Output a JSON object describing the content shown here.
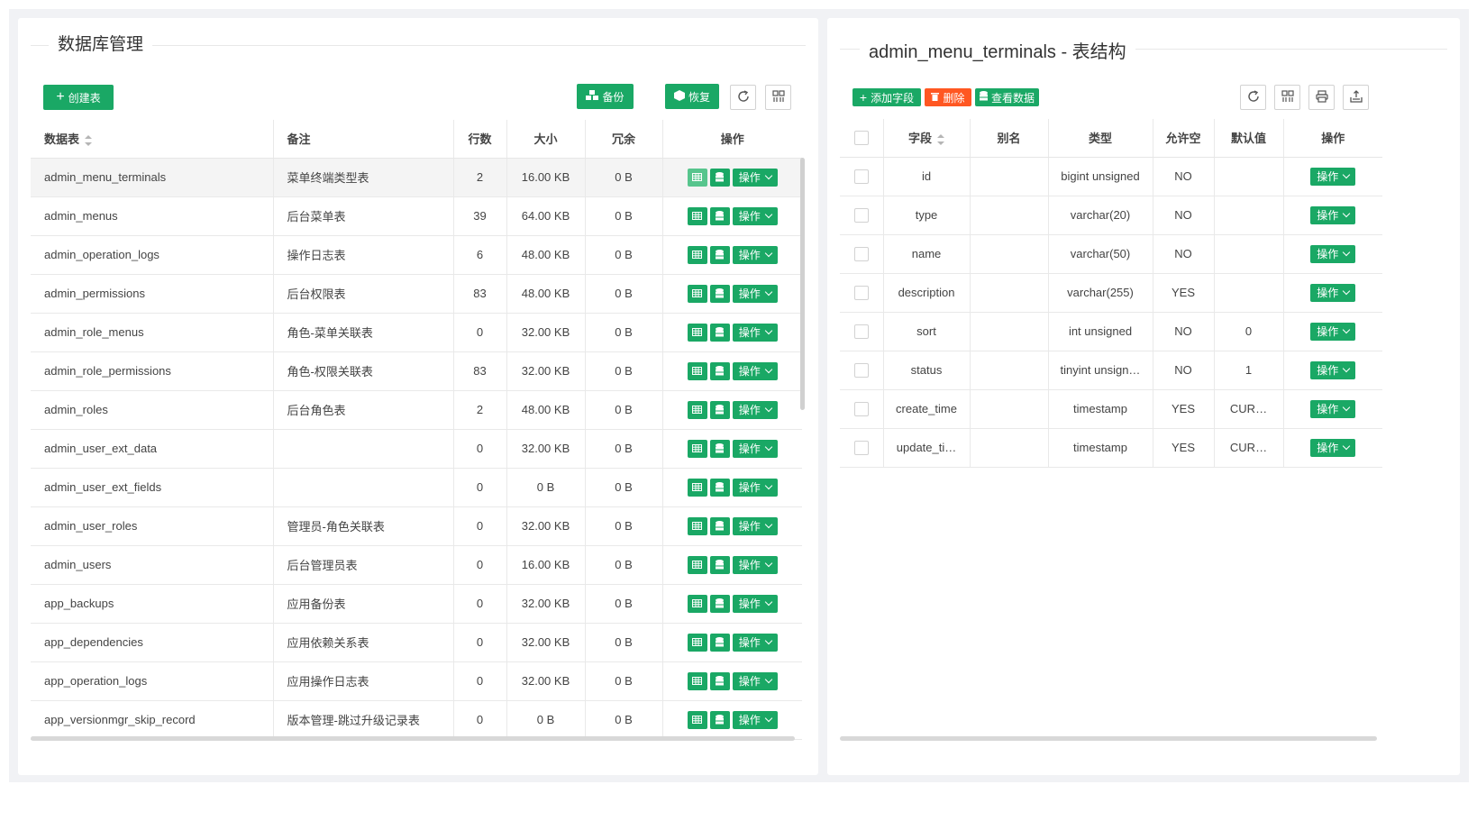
{
  "left": {
    "title": "数据库管理",
    "toolbar": {
      "create_label": "创建表",
      "backup_label": "备份",
      "restore_label": "恢复"
    },
    "columns": [
      "数据表",
      "备注",
      "行数",
      "大小",
      "冗余",
      "操作"
    ],
    "action_label": "操作",
    "rows": [
      {
        "name": "admin_menu_terminals",
        "comment": "菜单终端类型表",
        "rows": "2",
        "size": "16.00 KB",
        "free": "0 B"
      },
      {
        "name": "admin_menus",
        "comment": "后台菜单表",
        "rows": "39",
        "size": "64.00 KB",
        "free": "0 B"
      },
      {
        "name": "admin_operation_logs",
        "comment": "操作日志表",
        "rows": "6",
        "size": "48.00 KB",
        "free": "0 B"
      },
      {
        "name": "admin_permissions",
        "comment": "后台权限表",
        "rows": "83",
        "size": "48.00 KB",
        "free": "0 B"
      },
      {
        "name": "admin_role_menus",
        "comment": "角色-菜单关联表",
        "rows": "0",
        "size": "32.00 KB",
        "free": "0 B"
      },
      {
        "name": "admin_role_permissions",
        "comment": "角色-权限关联表",
        "rows": "83",
        "size": "32.00 KB",
        "free": "0 B"
      },
      {
        "name": "admin_roles",
        "comment": "后台角色表",
        "rows": "2",
        "size": "48.00 KB",
        "free": "0 B"
      },
      {
        "name": "admin_user_ext_data",
        "comment": "",
        "rows": "0",
        "size": "32.00 KB",
        "free": "0 B"
      },
      {
        "name": "admin_user_ext_fields",
        "comment": "",
        "rows": "0",
        "size": "0 B",
        "free": "0 B"
      },
      {
        "name": "admin_user_roles",
        "comment": "管理员-角色关联表",
        "rows": "0",
        "size": "32.00 KB",
        "free": "0 B"
      },
      {
        "name": "admin_users",
        "comment": "后台管理员表",
        "rows": "0",
        "size": "16.00 KB",
        "free": "0 B"
      },
      {
        "name": "app_backups",
        "comment": "应用备份表",
        "rows": "0",
        "size": "32.00 KB",
        "free": "0 B"
      },
      {
        "name": "app_dependencies",
        "comment": "应用依赖关系表",
        "rows": "0",
        "size": "32.00 KB",
        "free": "0 B"
      },
      {
        "name": "app_operation_logs",
        "comment": "应用操作日志表",
        "rows": "0",
        "size": "32.00 KB",
        "free": "0 B"
      },
      {
        "name": "app_versionmgr_skip_record",
        "comment": "版本管理-跳过升级记录表",
        "rows": "0",
        "size": "0 B",
        "free": "0 B"
      }
    ]
  },
  "right": {
    "title": "admin_menu_terminals - 表结构",
    "toolbar": {
      "add_field_label": "添加字段",
      "delete_label": "删除",
      "view_data_label": "查看数据"
    },
    "columns": [
      "字段",
      "别名",
      "类型",
      "允许空",
      "默认值",
      "操作"
    ],
    "action_label": "操作",
    "fields": [
      {
        "field": "id",
        "alias": "",
        "type": "bigint unsigned",
        "nullable": "NO",
        "default": ""
      },
      {
        "field": "type",
        "alias": "",
        "type": "varchar(20)",
        "nullable": "NO",
        "default": ""
      },
      {
        "field": "name",
        "alias": "",
        "type": "varchar(50)",
        "nullable": "NO",
        "default": ""
      },
      {
        "field": "description",
        "alias": "",
        "type": "varchar(255)",
        "nullable": "YES",
        "default": ""
      },
      {
        "field": "sort",
        "alias": "",
        "type": "int unsigned",
        "nullable": "NO",
        "default": "0"
      },
      {
        "field": "status",
        "alias": "",
        "type": "tinyint unsign…",
        "nullable": "NO",
        "default": "1"
      },
      {
        "field": "create_time",
        "alias": "",
        "type": "timestamp",
        "nullable": "YES",
        "default": "CUR…"
      },
      {
        "field": "update_ti…",
        "alias": "",
        "type": "timestamp",
        "nullable": "YES",
        "default": "CUR…"
      }
    ]
  },
  "colors": {
    "primary": "#1aa865",
    "danger": "#ff5722",
    "background": "#f1f2f5"
  },
  "icons": [
    "plus-icon",
    "cubes-icon",
    "cube-icon",
    "refresh-icon",
    "columns-icon",
    "print-icon",
    "export-icon",
    "table-icon",
    "database-icon",
    "trash-icon"
  ]
}
